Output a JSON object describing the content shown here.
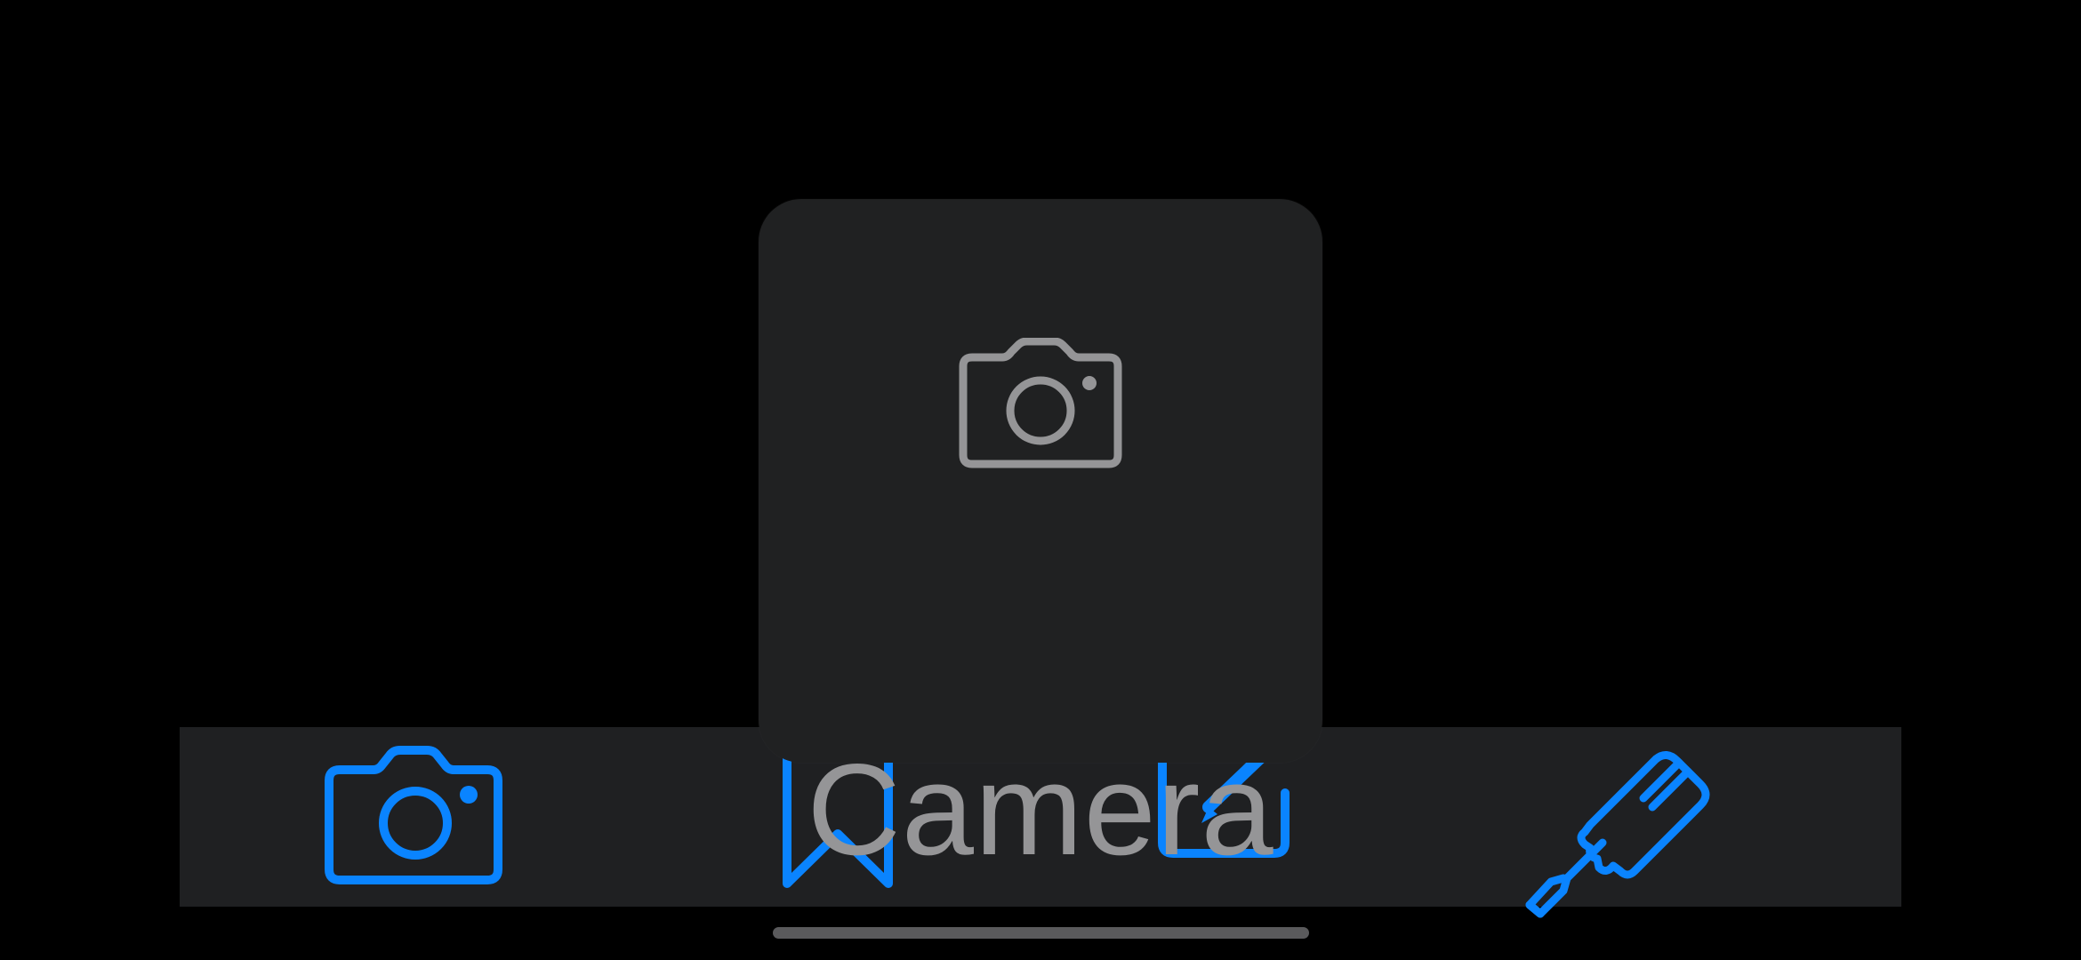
{
  "colors": {
    "background": "#000000",
    "tab_bar": "#1f2022",
    "accent": "#0a84ff",
    "hud_background": "#202122",
    "hud_foreground": "#959597",
    "home_indicator": "#5a5a5c"
  },
  "tab_bar": {
    "items": [
      {
        "icon": "camera-icon"
      },
      {
        "icon": "bookmark-icon"
      },
      {
        "icon": "compose-icon"
      },
      {
        "icon": "screwdriver-icon"
      }
    ]
  },
  "hud": {
    "icon": "camera-icon",
    "label": "Camera"
  }
}
